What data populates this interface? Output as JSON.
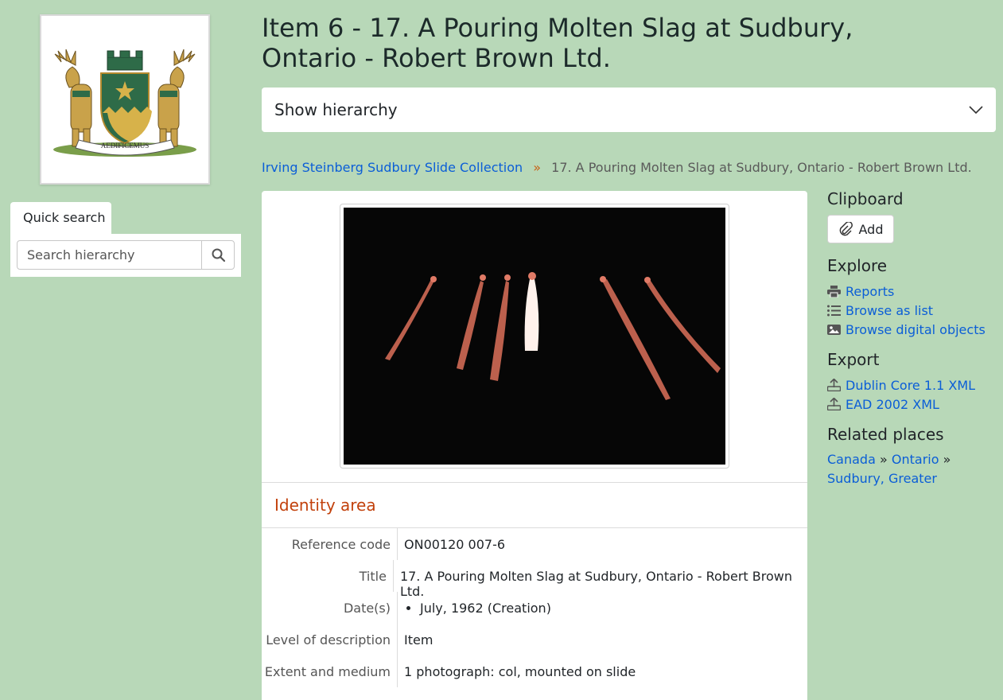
{
  "header": {
    "title": "Item 6 - 17. A Pouring Molten Slag at Sudbury, Ontario - Robert Brown Ltd."
  },
  "logo": {
    "motto": "AEDIFICEMUS"
  },
  "quick_search": {
    "tab_label": "Quick search",
    "placeholder": "Search hierarchy"
  },
  "hierarchy": {
    "label": "Show hierarchy"
  },
  "breadcrumb": {
    "parent": "Irving Steinberg Sudbury Slide Collection",
    "separator": "»",
    "current": "17. A Pouring Molten Slag at Sudbury, Ontario - Robert Brown Ltd."
  },
  "identity": {
    "heading": "Identity area",
    "fields": [
      {
        "label": "Reference code",
        "value": "ON00120 007-6"
      },
      {
        "label": "Title",
        "value": "17. A Pouring Molten Slag at Sudbury, Ontario - Robert Brown Ltd."
      },
      {
        "label": "Date(s)",
        "value": "July, 1962 (Creation)"
      },
      {
        "label": "Level of description",
        "value": "Item"
      },
      {
        "label": "Extent and medium",
        "value": "1 photograph: col, mounted on slide"
      }
    ]
  },
  "clipboard": {
    "heading": "Clipboard",
    "add_label": "Add"
  },
  "explore": {
    "heading": "Explore",
    "items": [
      {
        "label": "Reports",
        "icon": "printer-icon"
      },
      {
        "label": "Browse as list",
        "icon": "list-icon"
      },
      {
        "label": "Browse digital objects",
        "icon": "image-icon"
      }
    ]
  },
  "export": {
    "heading": "Export",
    "items": [
      {
        "label": "Dublin Core 1.1 XML",
        "icon": "upload-icon"
      },
      {
        "label": "EAD 2002 XML",
        "icon": "upload-icon"
      }
    ]
  },
  "related_places": {
    "heading": "Related places",
    "items": [
      "Canada",
      "Ontario",
      "Sudbury, Greater"
    ],
    "separator": "»"
  },
  "colors": {
    "background": "#b8d8b8",
    "link": "#0b5ed7",
    "area_heading": "#c2410c",
    "breadcrumb_separator": "#c95f12"
  }
}
